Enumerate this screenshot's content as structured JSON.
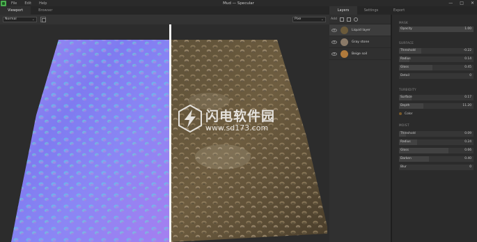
{
  "window": {
    "title": "Mud — Specular",
    "menu": [
      "File",
      "Edit",
      "Help"
    ],
    "controls": [
      "—",
      "□",
      "✕"
    ]
  },
  "left_tabs": [
    "Viewport",
    "Browser"
  ],
  "viewport_toolbar": {
    "mode": "Normal",
    "preview": "Pixe"
  },
  "right_tabs": [
    "Layers",
    "Settings",
    "Export"
  ],
  "layers": {
    "toolbar_label": "Add",
    "items": [
      {
        "name": "Liquid layer",
        "color": "#6b5a3a"
      },
      {
        "name": "Gray stone",
        "color": "#8a7a68"
      },
      {
        "name": "Beige soil",
        "color": "#b07a3c"
      }
    ]
  },
  "inspector": {
    "mask": {
      "title": "MASK",
      "props": [
        {
          "name": "Opacity",
          "value": "1.00",
          "fill": 1.0
        }
      ]
    },
    "surface": {
      "title": "SURFACE",
      "props": [
        {
          "name": "Threshold",
          "value": "-0.22",
          "fill": 0.3
        },
        {
          "name": "Radius",
          "value": "0.14",
          "fill": 0.14
        },
        {
          "name": "Gloss",
          "value": "0.45",
          "fill": 0.45
        },
        {
          "name": "Detail",
          "value": "0",
          "fill": 0
        }
      ]
    },
    "turbidity": {
      "title": "TURBIDITY",
      "props": [
        {
          "name": "Surface",
          "value": "0.17",
          "fill": 0.17
        },
        {
          "name": "Depth",
          "value": "11.20",
          "fill": 0.33
        }
      ],
      "color_label": "Color",
      "color": "#7a5a2a"
    },
    "moist": {
      "title": "MOIST",
      "props": [
        {
          "name": "Threshold",
          "value": "0.09",
          "fill": 0.09
        },
        {
          "name": "Radius",
          "value": "0.24",
          "fill": 0.24
        },
        {
          "name": "Gloss",
          "value": "0.66",
          "fill": 0.66
        },
        {
          "name": "Darken",
          "value": "0.40",
          "fill": 0.4
        },
        {
          "name": "Blur",
          "value": "0",
          "fill": 0
        }
      ]
    }
  },
  "watermark": {
    "chinese": "闪电软件园",
    "url": "www.sd173.com"
  }
}
